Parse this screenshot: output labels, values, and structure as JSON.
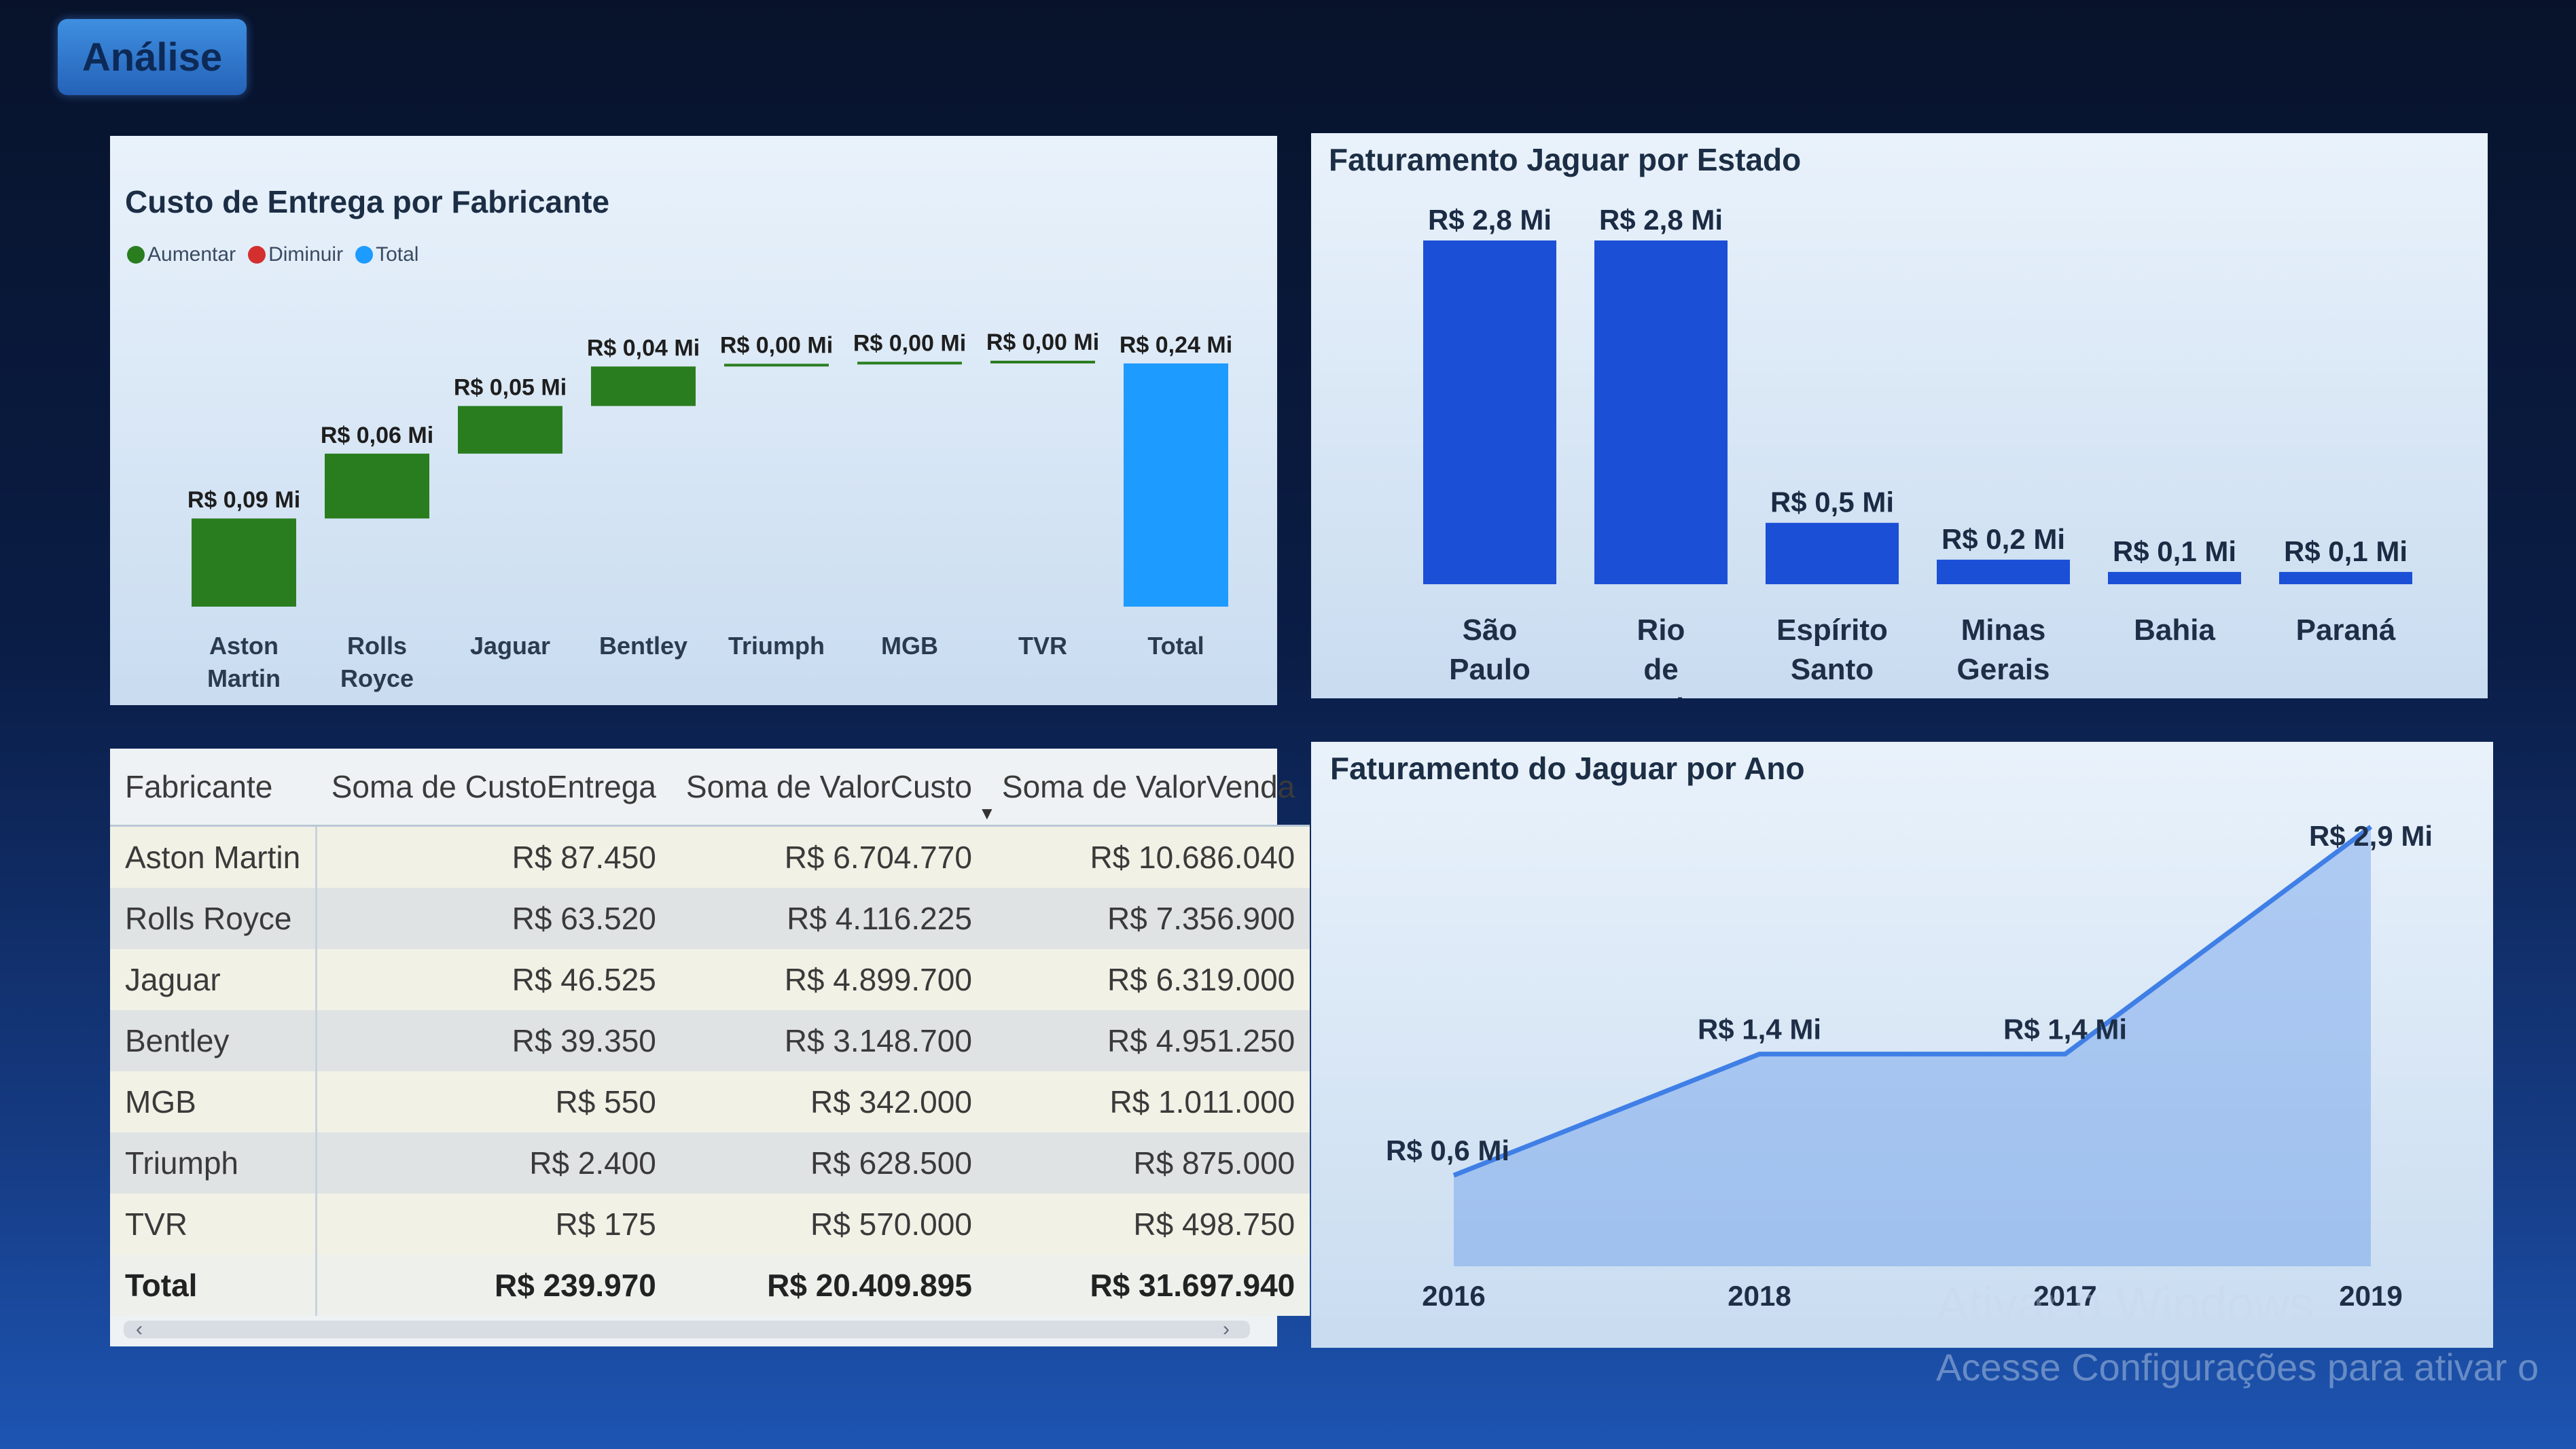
{
  "tab": {
    "label": "Análise"
  },
  "waterfall": {
    "title": "Custo de Entrega por Fabricante",
    "legend": [
      {
        "label": "Aumentar",
        "color": "#2a7d1f"
      },
      {
        "label": "Diminuir",
        "color": "#d32f2f"
      },
      {
        "label": "Total",
        "color": "#1e9bff"
      }
    ]
  },
  "table": {
    "headers": [
      "Fabricante",
      "Soma de CustoEntrega",
      "Soma de ValorCusto",
      "Soma de ValorVenda"
    ],
    "rows": [
      [
        "Aston Martin",
        "R$ 87.450",
        "R$ 6.704.770",
        "R$ 10.686.040"
      ],
      [
        "Rolls Royce",
        "R$ 63.520",
        "R$ 4.116.225",
        "R$ 7.356.900"
      ],
      [
        "Jaguar",
        "R$ 46.525",
        "R$ 4.899.700",
        "R$ 6.319.000"
      ],
      [
        "Bentley",
        "R$ 39.350",
        "R$ 3.148.700",
        "R$ 4.951.250"
      ],
      [
        "MGB",
        "R$ 550",
        "R$ 342.000",
        "R$ 1.011.000"
      ],
      [
        "Triumph",
        "R$ 2.400",
        "R$ 628.500",
        "R$ 875.000"
      ],
      [
        "TVR",
        "R$ 175",
        "R$ 570.000",
        "R$ 498.750"
      ]
    ],
    "total": [
      "Total",
      "R$ 239.970",
      "R$ 20.409.895",
      "R$ 31.697.940"
    ]
  },
  "watermark": {
    "line1": "Ativar o Windows",
    "line2": "Acesse Configurações para ativar o"
  },
  "chart_data": [
    {
      "type": "waterfall",
      "title": "Custo de Entrega por Fabricante",
      "categories": [
        "Aston Martin",
        "Rolls Royce",
        "Jaguar",
        "Bentley",
        "Triumph",
        "MGB",
        "TVR",
        "Total"
      ],
      "values": [
        0.087,
        0.064,
        0.047,
        0.039,
        0.002,
        0.001,
        0.0002,
        0.24
      ],
      "data_labels": [
        "R$ 0,09 Mi",
        "R$ 0,06 Mi",
        "R$ 0,05 Mi",
        "R$ 0,04 Mi",
        "R$ 0,00 Mi",
        "R$ 0,00 Mi",
        "R$ 0,00 Mi",
        "R$ 0,24 Mi"
      ],
      "kinds": [
        "increase",
        "increase",
        "increase",
        "increase",
        "increase",
        "increase",
        "increase",
        "total"
      ],
      "colors": {
        "increase": "#2a7d1f",
        "decrease": "#d32f2f",
        "total": "#1e9bff"
      },
      "legend": [
        "Aumentar",
        "Diminuir",
        "Total"
      ],
      "ylim": [
        0,
        0.24
      ]
    },
    {
      "type": "bar",
      "title": "Faturamento Jaguar por Estado",
      "categories": [
        "São Paulo",
        "Rio de Janeiro",
        "Espírito Santo",
        "Minas Gerais",
        "Bahia",
        "Paraná"
      ],
      "values": [
        2.8,
        2.8,
        0.5,
        0.2,
        0.1,
        0.1
      ],
      "data_labels": [
        "R$ 2,8 Mi",
        "R$ 2,8 Mi",
        "R$ 0,5 Mi",
        "R$ 0,2 Mi",
        "R$ 0,1 Mi",
        "R$ 0,1 Mi"
      ],
      "color": "#1a4fd6",
      "ylim": [
        0,
        2.8
      ]
    },
    {
      "type": "area",
      "title": "Faturamento do Jaguar por Ano",
      "x": [
        "2016",
        "2018",
        "2017",
        "2019"
      ],
      "values": [
        0.6,
        1.4,
        1.4,
        2.9
      ],
      "data_labels": [
        "R$ 0,6 Mi",
        "R$ 1,4 Mi",
        "R$ 1,4 Mi",
        "R$ 2,9 Mi"
      ],
      "color": "#3f7fe6",
      "ylim": [
        0,
        2.9
      ]
    }
  ]
}
